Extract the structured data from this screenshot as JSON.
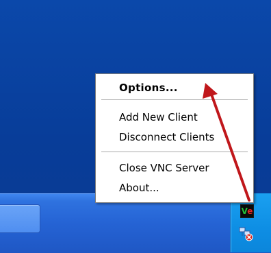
{
  "menu": {
    "options_label": "Options...",
    "add_client_label": "Add New Client",
    "disconnect_label": "Disconnect Clients",
    "close_label": "Close VNC Server",
    "about_label": "About..."
  },
  "tray": {
    "vnc_icon_name": "vnc-server-icon",
    "network_icon_name": "network-disconnected-icon"
  },
  "annotation": {
    "arrow_color": "#c0171b"
  }
}
